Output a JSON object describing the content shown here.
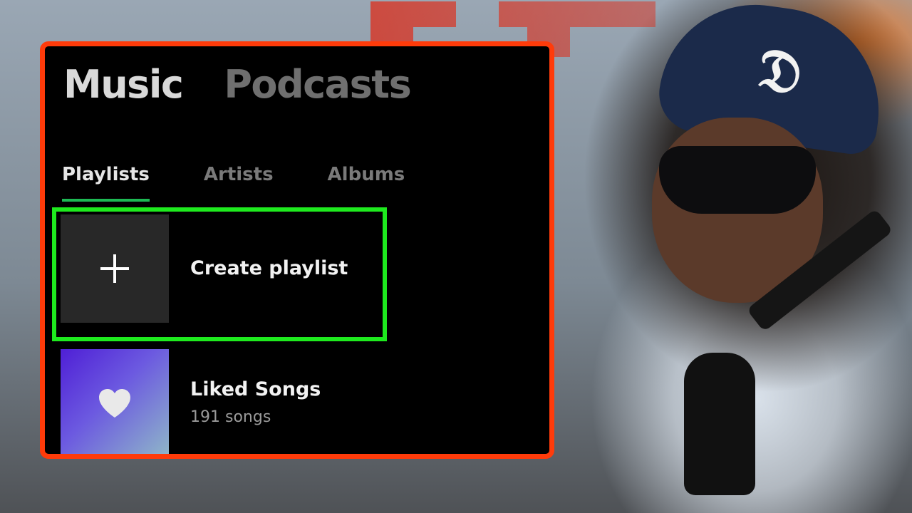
{
  "header": {
    "tabs": [
      {
        "label": "Music",
        "active": true
      },
      {
        "label": "Podcasts",
        "active": false
      }
    ]
  },
  "library": {
    "filters": [
      {
        "label": "Playlists",
        "active": true
      },
      {
        "label": "Artists",
        "active": false
      },
      {
        "label": "Albums",
        "active": false
      }
    ],
    "items": [
      {
        "title": "Create playlist",
        "icon": "plus-icon",
        "highlighted": true
      },
      {
        "title": "Liked Songs",
        "subtitle": "191 songs",
        "icon": "heart-icon"
      }
    ]
  },
  "colors": {
    "panel_border": "#ff3b0a",
    "highlight_border": "#1eea1e",
    "active_tab_indicator": "#1db954",
    "panel_background": "#000000"
  }
}
